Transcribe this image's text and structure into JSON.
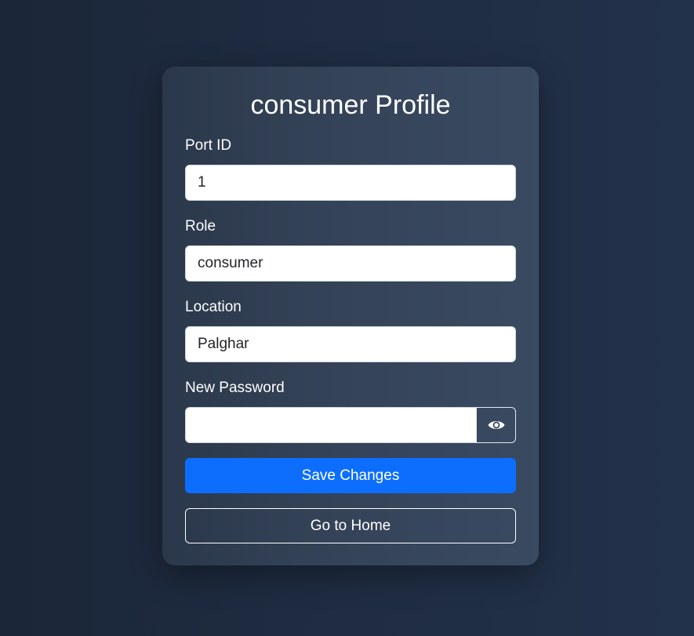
{
  "page": {
    "title": "consumer Profile"
  },
  "form": {
    "port_id": {
      "label": "Port ID",
      "value": "1"
    },
    "role": {
      "label": "Role",
      "value": "consumer"
    },
    "location": {
      "label": "Location",
      "value": "Palghar"
    },
    "new_password": {
      "label": "New Password",
      "value": "",
      "toggle_icon": "eye-icon"
    }
  },
  "actions": {
    "save_label": "Save Changes",
    "home_label": "Go to Home"
  },
  "colors": {
    "primary": "#0d6efd",
    "card": "#344257",
    "background": "#1f2c42"
  }
}
